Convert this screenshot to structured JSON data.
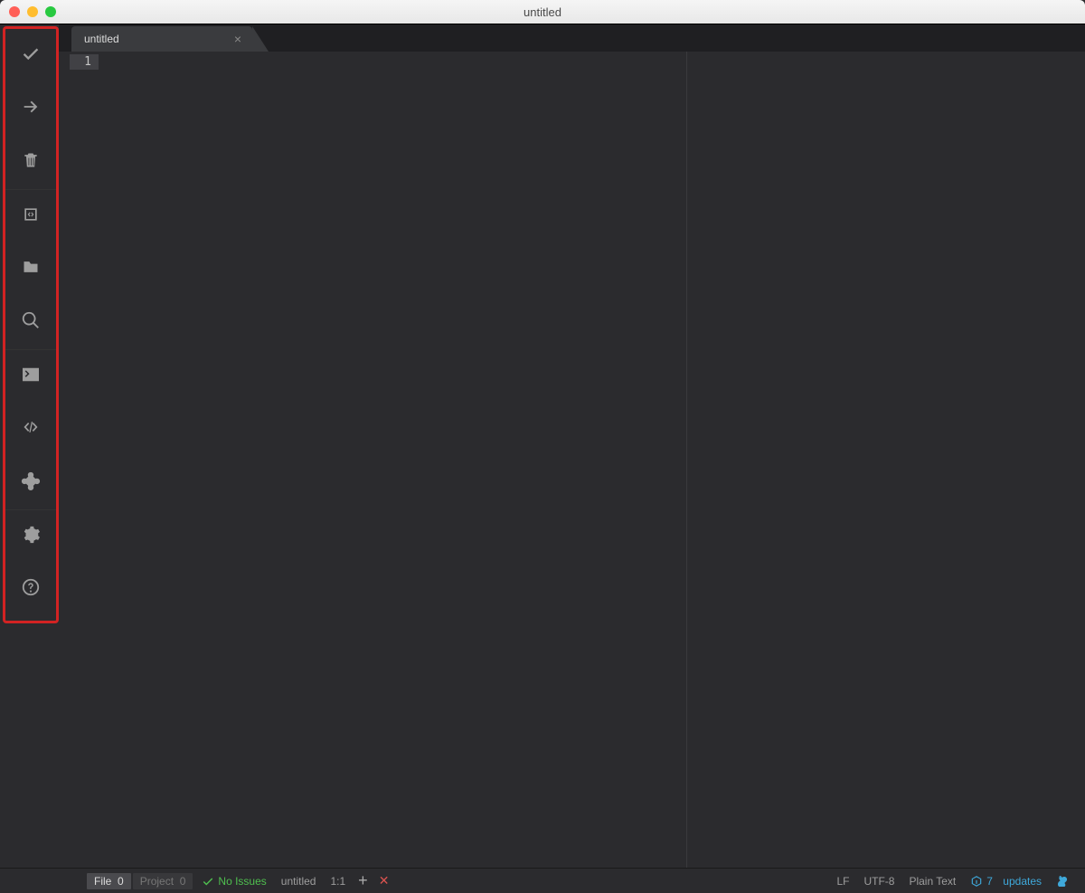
{
  "window": {
    "title": "untitled"
  },
  "tabs": [
    {
      "label": "untitled"
    }
  ],
  "editor": {
    "gutter_line": "1"
  },
  "sidebar": {
    "items": [
      {
        "name": "check-icon"
      },
      {
        "name": "arrow-right-icon"
      },
      {
        "name": "trash-icon"
      },
      {
        "name": "code-box-icon"
      },
      {
        "name": "folder-icon"
      },
      {
        "name": "search-icon"
      },
      {
        "name": "terminal-icon"
      },
      {
        "name": "code-brackets-icon"
      },
      {
        "name": "plugin-icon"
      },
      {
        "name": "gear-icon"
      },
      {
        "name": "help-icon"
      }
    ]
  },
  "statusbar": {
    "file_label": "File",
    "file_count": "0",
    "project_label": "Project",
    "project_count": "0",
    "issues_label": "No Issues",
    "file_name": "untitled",
    "cursor": "1:1",
    "line_ending": "LF",
    "encoding": "UTF-8",
    "syntax": "Plain Text",
    "updates_count": "7",
    "updates_label": "updates"
  }
}
